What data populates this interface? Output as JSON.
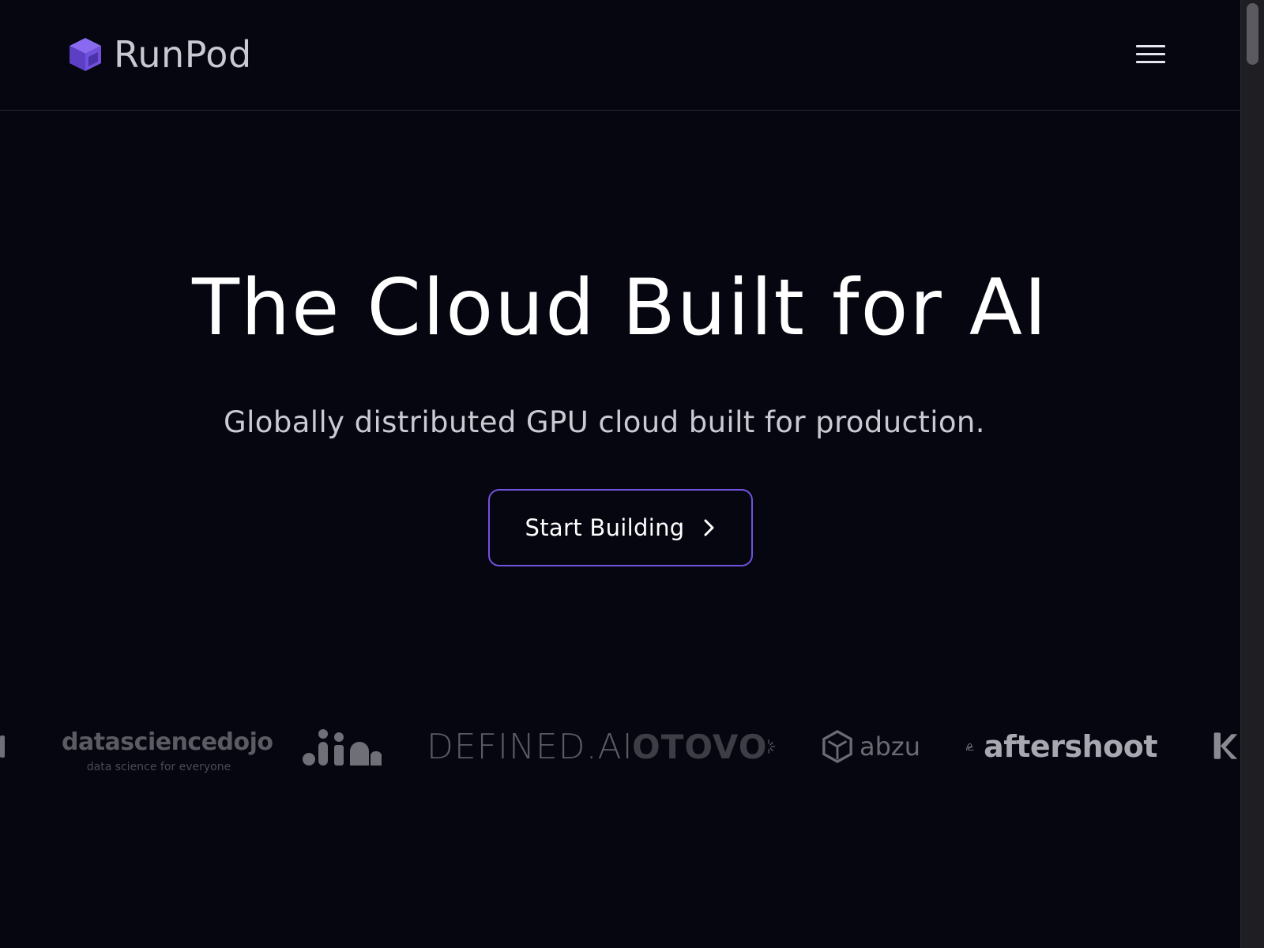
{
  "brand": {
    "name": "RunPod",
    "icon": "purple-cube-logo",
    "color": "#6e4ad9"
  },
  "header": {
    "menu_icon": "hamburger-menu-icon"
  },
  "hero": {
    "title": "The Cloud Built for AI",
    "subtitle": "Globally distributed GPU cloud built for production.",
    "cta_label": "Start Building",
    "cta_icon": "chevron-right-icon",
    "cta_border_color": "#7352e0"
  },
  "logos": [
    {
      "name": "datasciencedojo",
      "tagline": "data science for everyone"
    },
    {
      "name": "jina"
    },
    {
      "name": "DEFINED.AI"
    },
    {
      "name": "OTOVO"
    },
    {
      "name": "abzu"
    },
    {
      "name": "aftershoot"
    }
  ],
  "colors": {
    "background": "#05060f",
    "text_primary": "#ffffff",
    "text_secondary": "#c9cad2"
  }
}
